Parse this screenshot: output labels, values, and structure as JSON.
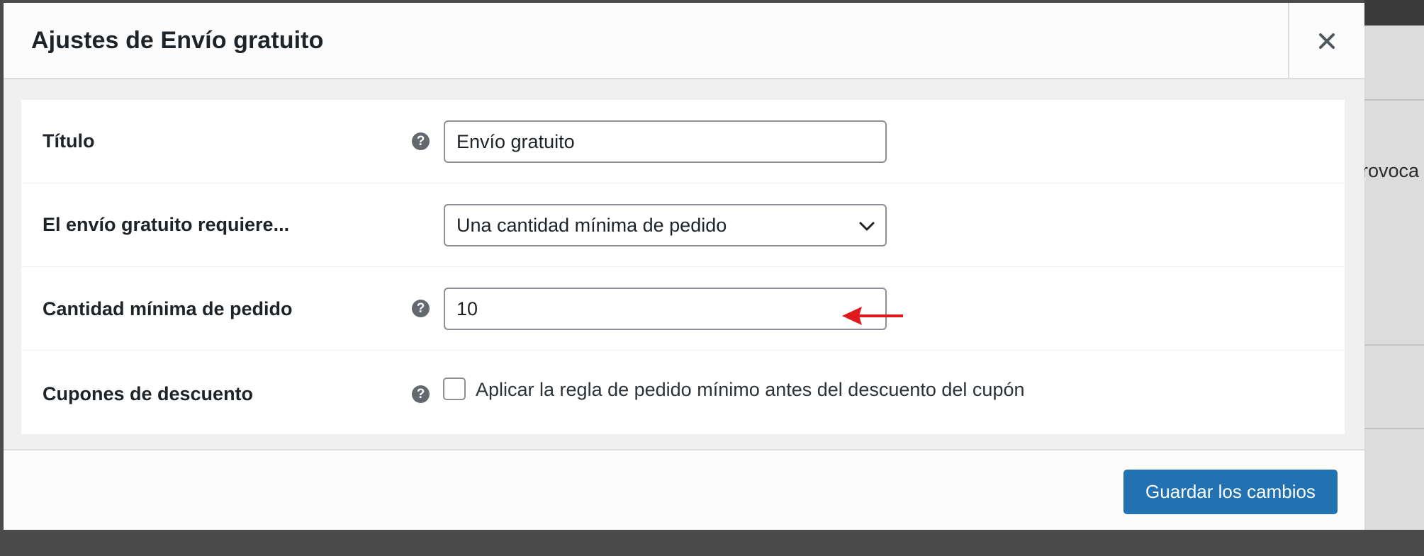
{
  "modal": {
    "title": "Ajustes de Envío gratuito",
    "close_icon": "close-icon"
  },
  "background": {
    "partial_text": "rovoca"
  },
  "form": {
    "rows": [
      {
        "label": "Título",
        "help_icon": "help-icon",
        "value": "Envío gratuito"
      },
      {
        "label": "El envío gratuito requiere...",
        "selected": "Una cantidad mínima de pedido",
        "select_icon": "chevron-down-icon"
      },
      {
        "label": "Cantidad mínima de pedido",
        "help_icon": "help-icon",
        "value": "10"
      },
      {
        "label": "Cupones de descuento",
        "help_icon": "help-icon",
        "checkbox_checked": false,
        "checkbox_label": "Aplicar la regla de pedido mínimo antes del descuento del cupón"
      }
    ]
  },
  "footer": {
    "save_label": "Guardar los cambios"
  },
  "colors": {
    "primary": "#2271b1",
    "annotation_arrow": "#e0191c",
    "overlay": "#4b4b4b"
  }
}
